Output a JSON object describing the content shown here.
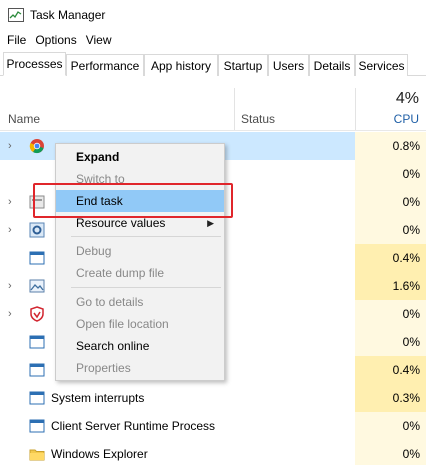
{
  "window": {
    "title": "Task Manager"
  },
  "menubar": {
    "items": [
      "File",
      "Options",
      "View"
    ]
  },
  "tabs": [
    {
      "label": "Processes",
      "active": true
    },
    {
      "label": "Performance",
      "active": false
    },
    {
      "label": "App history",
      "active": false
    },
    {
      "label": "Startup",
      "active": false
    },
    {
      "label": "Users",
      "active": false
    },
    {
      "label": "Details",
      "active": false
    },
    {
      "label": "Services",
      "active": false
    }
  ],
  "header": {
    "name_label": "Name",
    "status_label": "Status",
    "cpu_total": "4%",
    "cpu_label": "CPU"
  },
  "processes": [
    {
      "name": "",
      "cpu": "0.8%",
      "expandable": true,
      "icon": "chrome-icon",
      "selected": true
    },
    {
      "name": "",
      "cpu": "0%",
      "expandable": false,
      "icon": "",
      "selected": false
    },
    {
      "name": "",
      "cpu": "0%",
      "expandable": true,
      "icon": "app-icon",
      "selected": false
    },
    {
      "name": "",
      "cpu": "0%",
      "expandable": true,
      "icon": "settings-icon",
      "selected": false
    },
    {
      "name": "",
      "cpu": "0.4%",
      "expandable": false,
      "icon": "window-icon",
      "selected": false
    },
    {
      "name": "",
      "cpu": "1.6%",
      "expandable": true,
      "icon": "photo-icon",
      "selected": false
    },
    {
      "name": "",
      "cpu": "0%",
      "expandable": true,
      "icon": "shield-icon",
      "selected": false
    },
    {
      "name": "",
      "cpu": "0%",
      "expandable": false,
      "icon": "window-icon",
      "selected": false
    },
    {
      "name": "",
      "cpu": "0.4%",
      "expandable": false,
      "icon": "window-icon",
      "selected": false
    },
    {
      "name": "System interrupts",
      "cpu": "0.3%",
      "expandable": false,
      "icon": "window-icon",
      "selected": false
    },
    {
      "name": "Client Server Runtime Process",
      "cpu": "0%",
      "expandable": false,
      "icon": "window-icon",
      "selected": false
    },
    {
      "name": "Windows Explorer",
      "cpu": "0%",
      "expandable": false,
      "icon": "folder-icon",
      "selected": false
    }
  ],
  "context_menu": {
    "items": {
      "expand": "Expand",
      "switch_to": "Switch to",
      "end_task": "End task",
      "resource_values": "Resource values",
      "debug": "Debug",
      "create_dump": "Create dump file",
      "go_to_details": "Go to details",
      "open_file_location": "Open file location",
      "search_online": "Search online",
      "properties": "Properties"
    }
  },
  "colors": {
    "selection": "#cce8ff",
    "menu_hover": "#91c9f7",
    "highlight_border": "#e0262b",
    "cpu_heat": "#fff4c4"
  }
}
